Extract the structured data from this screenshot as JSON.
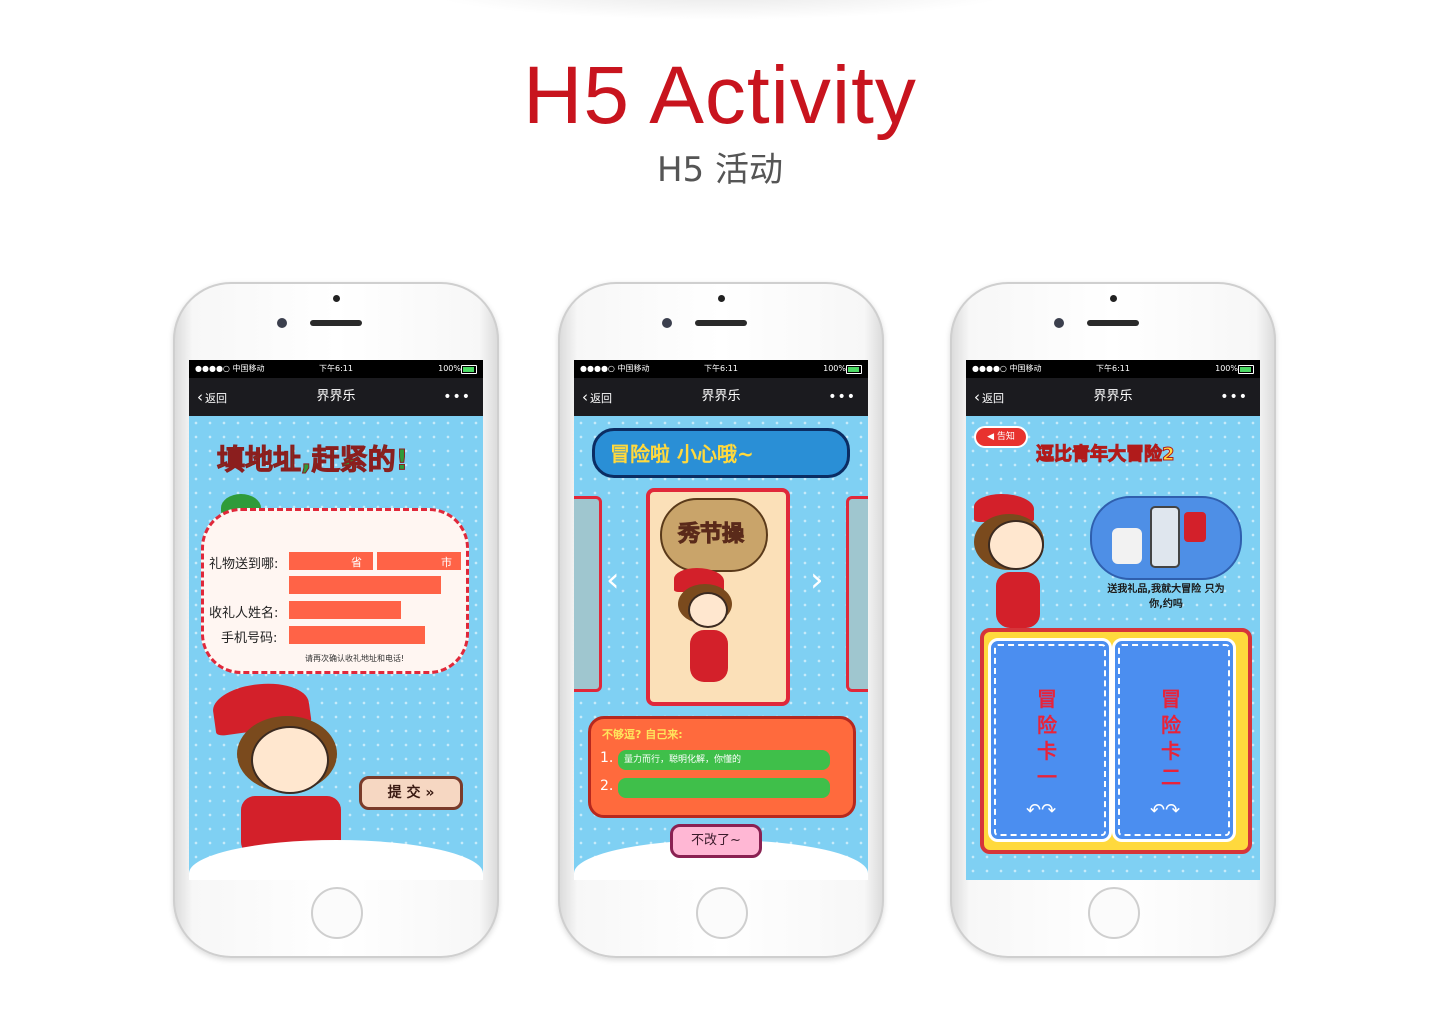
{
  "header": {
    "title": "H5 Activity",
    "subtitle": "H5 活动"
  },
  "status_bar": {
    "carrier": "●●●●○ 中国移动",
    "time": "下午6:11",
    "battery": "100%"
  },
  "nav": {
    "back": "返回",
    "title": "界界乐",
    "more": "•••"
  },
  "phones": [
    {
      "headline": "填地址,赶紧的!",
      "form": {
        "label_address": "礼物送到哪:",
        "province": "省",
        "city": "市",
        "label_name": "收礼人姓名:",
        "label_phone": "手机号码:",
        "note": "请再次确认收礼地址和电话!"
      },
      "submit": "提 交 »"
    },
    {
      "headline": "冒险啦 小心哦~",
      "card_text": "秀节操",
      "panel_title": "不够逗? 自己来:",
      "option1_num": "1.",
      "option1": "量力而行，聪明化解，你懂的",
      "option2_num": "2.",
      "option2": "",
      "button": "不改了~",
      "arrow_left": "‹",
      "arrow_right": "›"
    },
    {
      "badge": "告知",
      "headline": "逗比青年大冒险2",
      "speech": "送我礼品,我就大冒险 只为你,约吗",
      "card1": "冒险卡一",
      "card2": "冒险卡二",
      "card_arrows": "↶↷"
    }
  ],
  "colors": {
    "accent_red": "#c8141e",
    "sky_blue": "#7fd0f3",
    "field_orange": "#ff6347",
    "option_green": "#3fbf4a"
  }
}
